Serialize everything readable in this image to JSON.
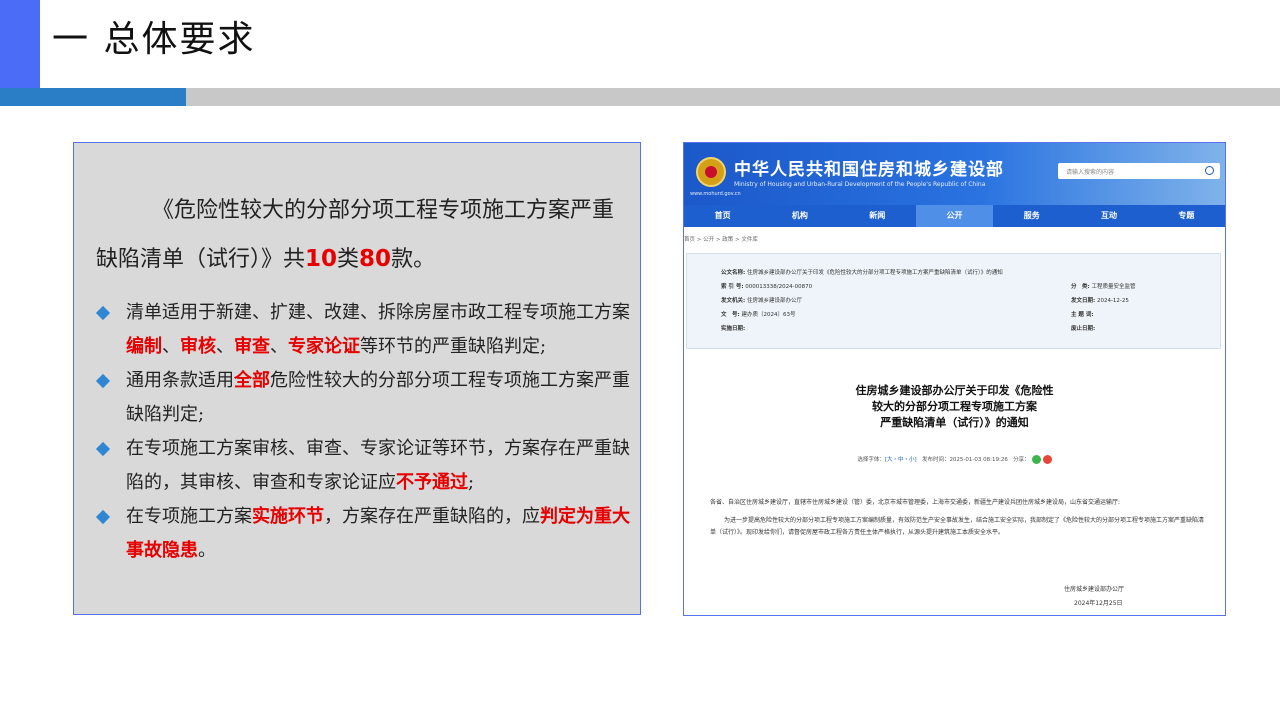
{
  "header": {
    "title": "一 总体要求"
  },
  "left_panel": {
    "intro_part1": "《危险性较大的分部分项工程专项施工方案严重缺陷清单（试行）》共",
    "intro_num1": "10",
    "intro_mid": "类",
    "intro_num2": "80",
    "intro_end": "款。",
    "bullets": [
      {
        "t1": "清单适用于新建、扩建、改建、拆除房屋市政工程专项施工方案",
        "r1": "编制",
        "t2": "、",
        "r2": "审核",
        "t3": "、",
        "r3": "审查",
        "t4": "、",
        "r4": "专家论证",
        "t5": "等环节的严重缺陷判定;"
      },
      {
        "t1": "通用条款适用",
        "r1": "全部",
        "t2": "危险性较大的分部分项工程专项施工方案严重缺陷判定;"
      },
      {
        "t1": "在专项施工方案审核、审查、专家论证等环节，方案存在严重缺陷的，其审核、审查和专家论证应",
        "r1": "不予通过",
        "t2": ";"
      },
      {
        "t1": "在专项施工方案",
        "r1": "实施环节",
        "t2": "，方案存在严重缺陷的，应",
        "r2": "判定为重大事故隐患",
        "t3": "。"
      }
    ]
  },
  "doc": {
    "title": "中华人民共和国住房和城乡建设部",
    "subtitle": "Ministry of Housing and Urban-Rural Development of the People's Republic of China",
    "url": "www.mohurd.gov.cn",
    "search_placeholder": "请输入搜索的内容",
    "nav": [
      "首页",
      "机构",
      "新闻",
      "公开",
      "服务",
      "互动",
      "专题"
    ],
    "breadcrumb": "首页 > 公开 > 政策 > 文件库",
    "meta": {
      "name_label": "公文名称:",
      "name_value": "住房城乡建设部办公厅关于印发《危险性较大的分部分项工程专项施工方案严重缺陷清单（试行）》的通知",
      "index_label": "索 引 号:",
      "index_value": "000013338/2024-00870",
      "cat_label": "分　类:",
      "cat_value": "工程质量安全监管",
      "org_label": "发文机关:",
      "org_value": "住房城乡建设部办公厅",
      "date_label": "发文日期:",
      "date_value": "2024-12-25",
      "num_label": "文　号:",
      "num_value": "建办质〔2024〕63号",
      "topic_label": "主 题 词:",
      "impl_label": "实施日期:",
      "expire_label": "废止日期:"
    },
    "article_title_1": "住房城乡建设部办公厅关于印发《危险性",
    "article_title_2": "较大的分部分项工程专项施工方案",
    "article_title_3": "严重缺陷清单（试行）》的通知",
    "font_label": "选择字体：",
    "font_opts": "[大・中・小]",
    "pub_time": "发布时间：2025-01-03 08:19:26",
    "share_label": "分享：",
    "body_p1": "各省、自治区住房城乡建设厅，直辖市住房城乡建设（管）委，北京市城市管理委，上海市交通委，新疆生产建设兵团住房城乡建设局，山东省交通运输厅:",
    "body_p2": "为进一步提高危险性较大的分部分项工程专项施工方案编制质量，有效防范生产安全事故发生，结合施工安全实际，我部制定了《危险性较大的分部分项工程专项施工方案严重缺陷清单（试行）》。现印发给你们，请督促房屋市政工程各方责任主体严格执行，从源头提升建筑施工本质安全水平。",
    "sign_org": "住房城乡建设部办公厅",
    "sign_date": "2024年12月25日"
  },
  "colors": {
    "accent_blue": "#4a6cf7",
    "highlight_red": "#e60000",
    "panel_gray": "#d9d9d9",
    "bullet_blue": "#2f86d2"
  }
}
